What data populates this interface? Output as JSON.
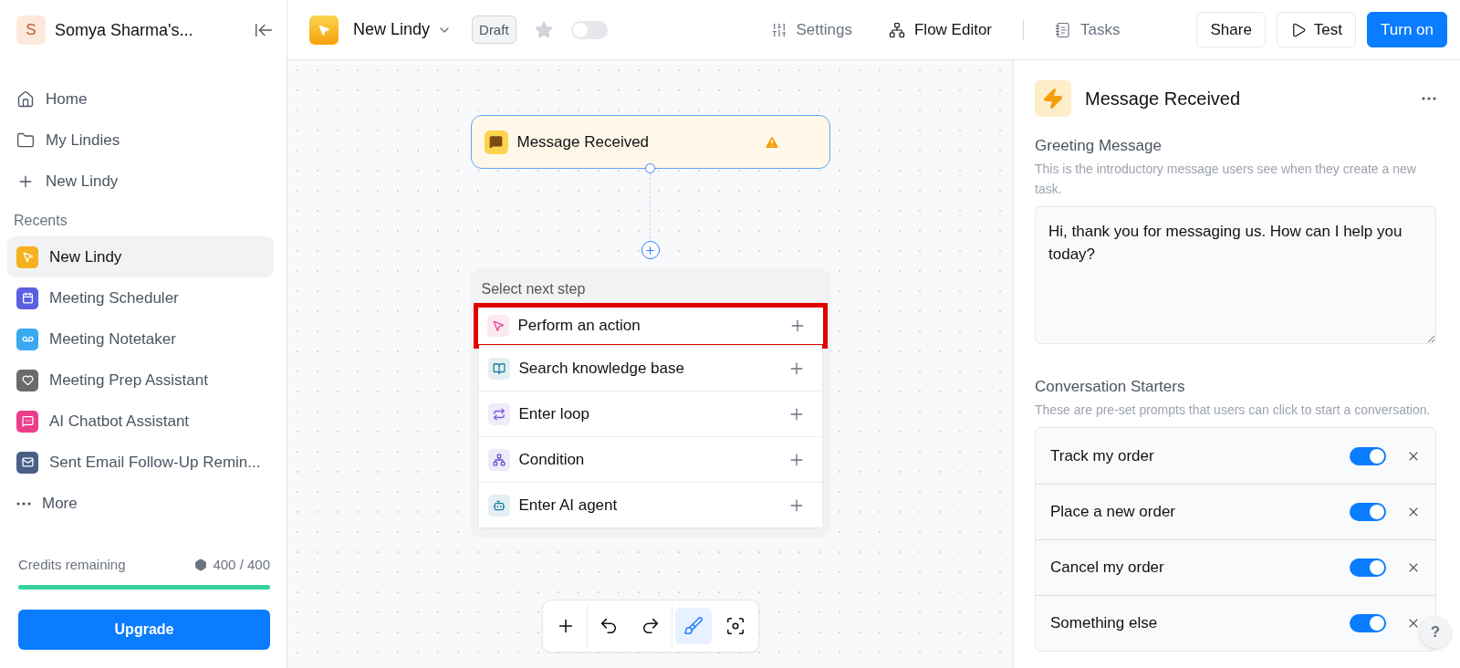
{
  "workspace": {
    "initial": "S",
    "name": "Somya Sharma's..."
  },
  "nav": [
    {
      "kind": "home",
      "label": "Home"
    },
    {
      "kind": "folder",
      "label": "My Lindies"
    },
    {
      "kind": "plus",
      "label": "New Lindy"
    }
  ],
  "recents_title": "Recents",
  "recents": [
    {
      "kind": "pointer",
      "label": "New Lindy",
      "color": "#f5b21e",
      "selected": true
    },
    {
      "kind": "calendar",
      "label": "Meeting Scheduler",
      "color": "#5b5fe0",
      "selected": false
    },
    {
      "kind": "voicemail",
      "label": "Meeting Notetaker",
      "color": "#3aa8f0",
      "selected": false
    },
    {
      "kind": "heart",
      "label": "Meeting Prep Assistant",
      "color": "#6b6b6b",
      "selected": false
    },
    {
      "kind": "chat",
      "label": "AI Chatbot Assistant",
      "color": "#ec3d8c",
      "selected": false
    },
    {
      "kind": "mail",
      "label": "Sent Email Follow-Up Remin...",
      "color": "#4a5f86",
      "selected": false
    }
  ],
  "more": "More",
  "credits": {
    "label": "Credits remaining",
    "reading": "400 / 400",
    "level": 1
  },
  "upgrade": "Upgrade",
  "header": {
    "title": "New Lindy",
    "badge": "Draft",
    "starred": false,
    "on": false,
    "tabs": [
      {
        "kind": "settings",
        "label": "Settings",
        "selected": false
      },
      {
        "kind": "flow",
        "label": "Flow Editor",
        "selected": true
      },
      {
        "kind": "tasks",
        "label": "Tasks",
        "selected": false
      }
    ],
    "share": "Share",
    "test": "Test",
    "turn_on": "Turn on"
  },
  "trigger": {
    "label": "Message Received",
    "warning": true
  },
  "next_step": {
    "title": "Select next step",
    "items": [
      {
        "kind": "action",
        "label": "Perform an action",
        "color": "#e8408f",
        "highlighted": true
      },
      {
        "kind": "knowledge",
        "label": "Search knowledge base",
        "color": "#1f7fa3",
        "highlighted": false
      },
      {
        "kind": "loop",
        "label": "Enter loop",
        "color": "#7b5be0",
        "highlighted": false
      },
      {
        "kind": "condition",
        "label": "Condition",
        "color": "#6b4fd0",
        "highlighted": false
      },
      {
        "kind": "agent",
        "label": "Enter AI agent",
        "color": "#1f7fa3",
        "highlighted": false
      }
    ]
  },
  "toolbar": [
    {
      "kind": "add",
      "selected": false
    },
    {
      "kind": "undo",
      "selected": false
    },
    {
      "kind": "redo",
      "selected": false
    },
    {
      "kind": "clean",
      "selected": true
    },
    {
      "kind": "focus",
      "selected": false
    }
  ],
  "panel": {
    "title": "Message Received",
    "greeting": {
      "label": "Greeting Message",
      "description": "This is the introductory message users see when they create a new task.",
      "value": "Hi, thank you for messaging us. How can I help you today?"
    },
    "starters": {
      "label": "Conversation Starters",
      "description": "These are pre-set prompts that users can click to start a conversation.",
      "items": [
        {
          "label": "Track my order",
          "on": true
        },
        {
          "label": "Place a new order",
          "on": true
        },
        {
          "label": "Cancel my order",
          "on": true
        },
        {
          "label": "Something else",
          "on": true
        }
      ]
    }
  },
  "help": "?"
}
